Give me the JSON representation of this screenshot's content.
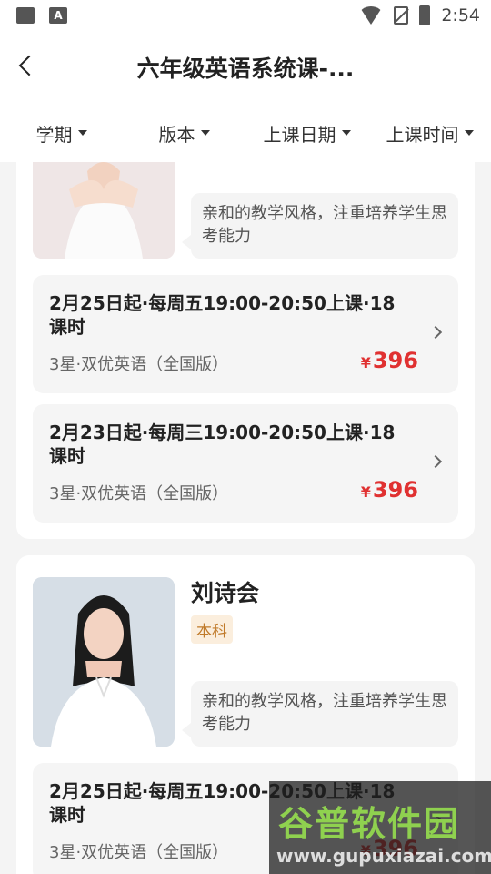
{
  "status_bar": {
    "time": "2:54",
    "icons": [
      "image-icon",
      "text-a-icon",
      "wifi-icon",
      "no-sim-icon",
      "battery-charging-icon"
    ]
  },
  "header": {
    "title": "六年级英语系统课-...",
    "back_icon": "chevron-left-icon"
  },
  "filters": [
    {
      "label": "学期"
    },
    {
      "label": "版本"
    },
    {
      "label": "上课日期"
    },
    {
      "label": "上课时间"
    }
  ],
  "teachers": [
    {
      "name": "",
      "tag": "",
      "description": "亲和的教学风格，注重培养学生思考能力",
      "sessions": [
        {
          "title": "2月25日起·每周五19:00-20:50上课·18课时",
          "subtitle": "3星·双优英语（全国版）",
          "price": "396",
          "currency": "¥"
        },
        {
          "title": "2月23日起·每周三19:00-20:50上课·18课时",
          "subtitle": "3星·双优英语（全国版）",
          "price": "396",
          "currency": "¥"
        }
      ]
    },
    {
      "name": "刘诗会",
      "tag": "本科",
      "description": "亲和的教学风格，注重培养学生思考能力",
      "sessions": [
        {
          "title": "2月25日起·每周五19:00-20:50上课·18课时",
          "subtitle": "3星·双优英语（全国版）",
          "price": "396",
          "currency": "¥"
        }
      ]
    }
  ],
  "watermark": {
    "main": "谷普软件园",
    "url": "www.gupuxiazai.com"
  },
  "colors": {
    "accent_price": "#e03131",
    "tag_text": "#c07a2a",
    "tag_bg": "#fbeedd"
  }
}
